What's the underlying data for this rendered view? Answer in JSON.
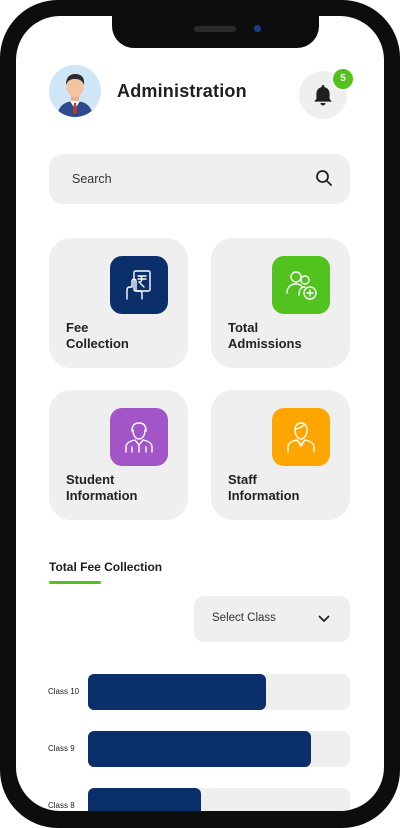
{
  "header": {
    "title": "Administration",
    "notification_count": "5"
  },
  "search": {
    "placeholder": "Search"
  },
  "cards": [
    {
      "label": "Fee\nCollection",
      "color": "#0b2f6b",
      "icon": "rupee-receipt-icon"
    },
    {
      "label": "Total\nAdmissions",
      "color": "#52c21e",
      "icon": "add-users-icon"
    },
    {
      "label": "Student\nInformation",
      "color": "#a155c7",
      "icon": "student-icon"
    },
    {
      "label": "Staff\nInformation",
      "color": "#ffa500",
      "icon": "staff-icon"
    }
  ],
  "fee_section": {
    "title": "Total Fee Collection",
    "accent": "#52c21e"
  },
  "class_select": {
    "selected": "Select Class"
  },
  "colors": {
    "bar_fill": "#0b2f6b",
    "bar_track": "#efefef"
  },
  "chart_data": {
    "type": "bar",
    "orientation": "horizontal",
    "categories": [
      "Class 10",
      "Class 9",
      "Class 8"
    ],
    "values": [
      0.68,
      0.85,
      0.43
    ],
    "title": "Total Fee Collection",
    "xlabel": "",
    "ylabel": "",
    "xlim": [
      0,
      1
    ]
  }
}
